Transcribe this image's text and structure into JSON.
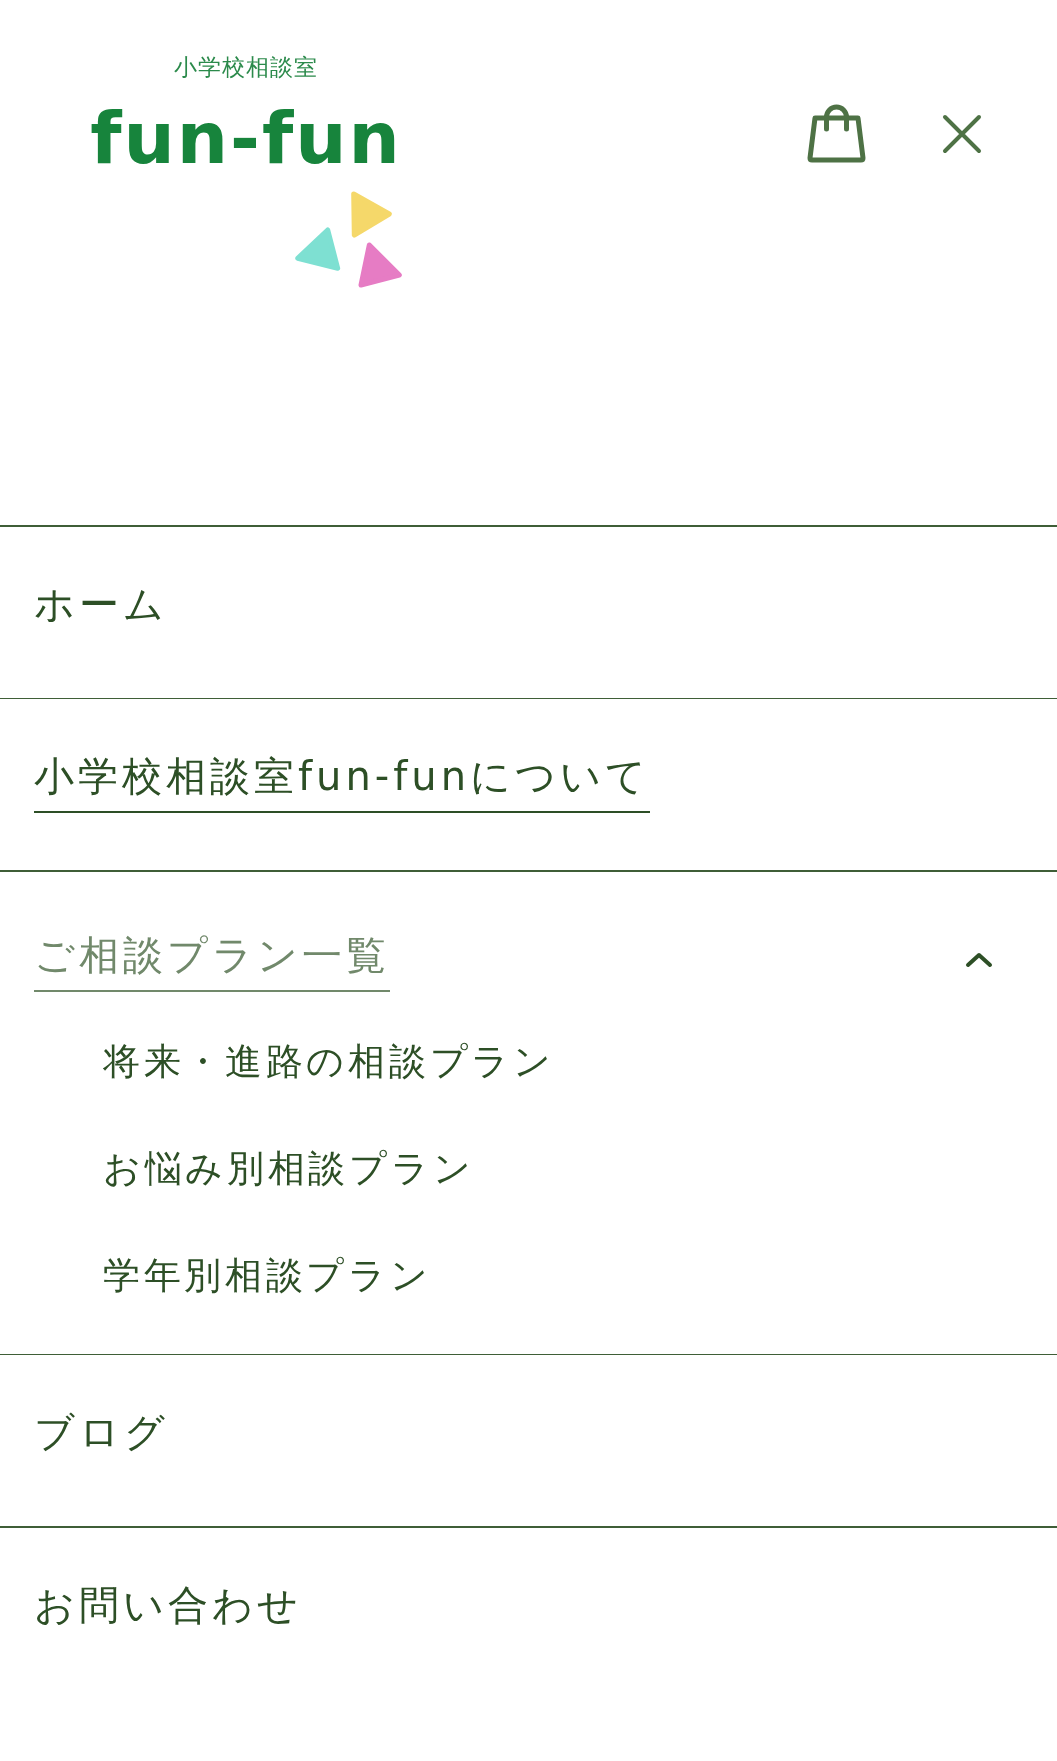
{
  "header": {
    "logo": {
      "subtitle": "小学校相談室",
      "name": "fun-fun"
    }
  },
  "menu": {
    "items": [
      {
        "kind": "link",
        "label": "ホーム",
        "selected": false
      },
      {
        "kind": "link",
        "label": "小学校相談室fun-funについて",
        "selected": true
      },
      {
        "kind": "group",
        "label": "ご相談プラン一覧",
        "selected": false,
        "expanded": true,
        "children": [
          {
            "label": "将来・進路の相談プラン",
            "selected": false
          },
          {
            "label": "お悩み別相談プラン",
            "selected": false
          },
          {
            "label": "学年別相談プラン",
            "selected": false
          }
        ]
      },
      {
        "kind": "link",
        "label": "ブログ",
        "selected": false
      },
      {
        "kind": "link",
        "label": "お問い合わせ",
        "selected": false
      }
    ]
  }
}
